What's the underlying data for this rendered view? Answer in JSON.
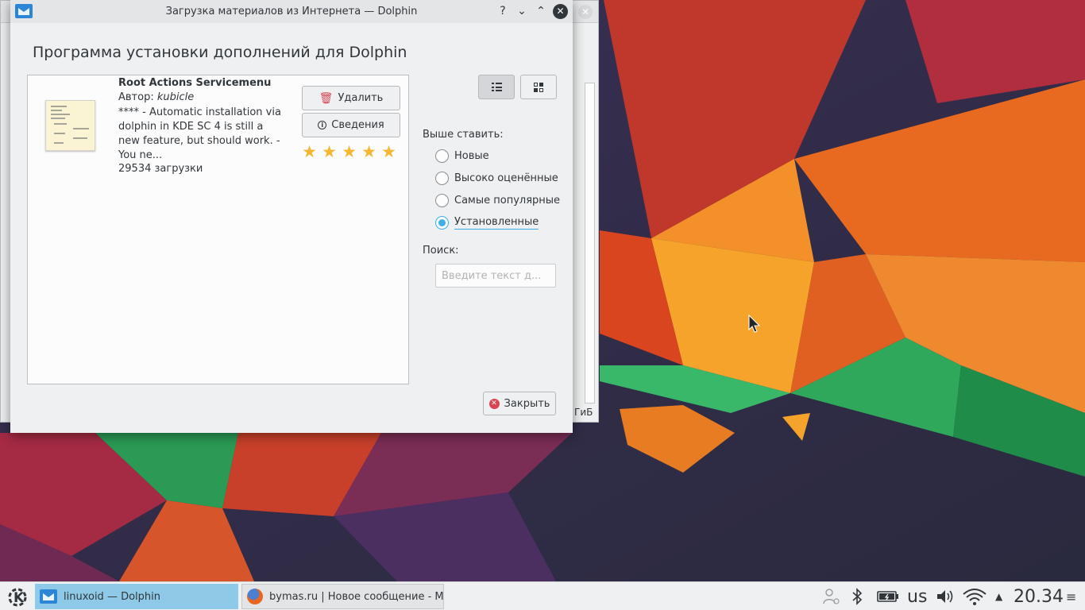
{
  "dialog": {
    "window_title": "Загрузка материалов из Интернета — Dolphin",
    "heading": "Программа установки дополнений для Dolphin",
    "titlebar_buttons": {
      "help": "?",
      "minimize": "⌄",
      "maximize": "⌃",
      "close": "✕"
    }
  },
  "item": {
    "name": "Root Actions Servicemenu",
    "author_prefix": "Автор: ",
    "author": "kubicle",
    "description": "**** - Automatic installation via dolphin in KDE SC 4 is still a new feature, but should work. - You ne...",
    "downloads": "29534 загрузки",
    "rating": 5,
    "uninstall_label": "Удалить",
    "details_label": "Сведения"
  },
  "sort": {
    "label": "Выше ставить:",
    "options": [
      "Новые",
      "Высоко оценённые",
      "Самые популярные",
      "Установленные"
    ],
    "selected": "Установленные"
  },
  "search": {
    "label": "Поиск:",
    "placeholder": "Введите текст д...",
    "value": ""
  },
  "close_label": "Закрыть",
  "background_window": {
    "size_fragment": "ГиБ"
  },
  "taskbar": {
    "tasks": [
      {
        "label": "linuxoid — Dolphin",
        "active": true
      },
      {
        "label": "bymas.ru | Новое сообщение - Mo",
        "active": false
      }
    ],
    "keyboard_layout": "us",
    "clock": "20.34"
  },
  "colors": {
    "accent": "#3daee9",
    "star": "#f6b632",
    "danger": "#da4453",
    "active_task": "#8ec9e8"
  }
}
